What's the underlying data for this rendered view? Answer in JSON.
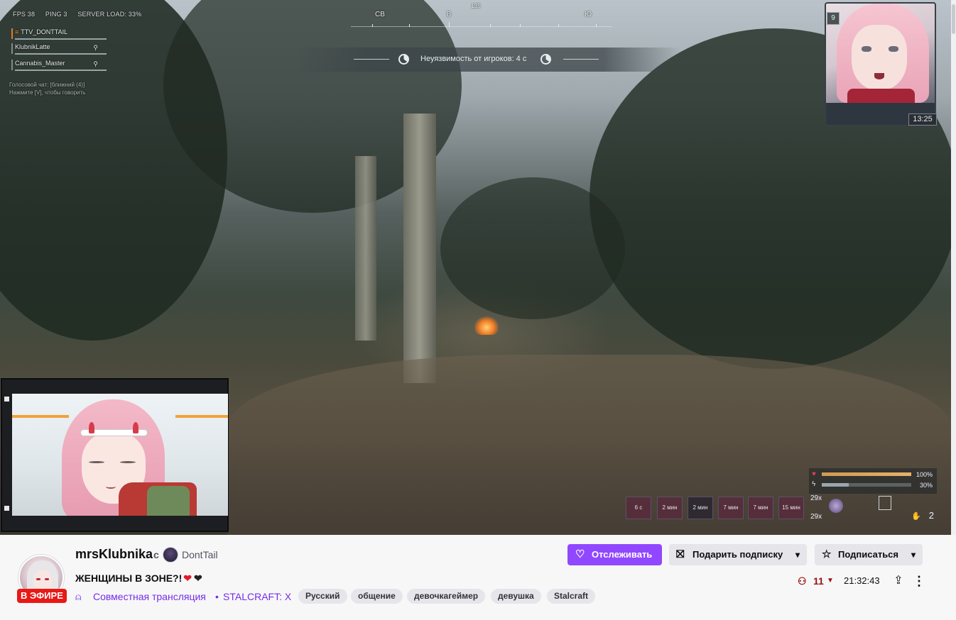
{
  "hud": {
    "fps": "FPS 38",
    "ping": "PING 3",
    "server_load": "SERVER LOAD: 33%",
    "party": [
      {
        "name": "TTV_DONTTAIL"
      },
      {
        "name": "KlubnikLatte"
      },
      {
        "name": "Cannabis_Master"
      }
    ],
    "voice_hint_1": "Голосовой чат: [ближний (4)]",
    "voice_hint_2": "Нажмите [V], чтобы говорить",
    "compass": {
      "nw": "СВ",
      "east": "В",
      "tick_135": "135",
      "south_e": "Ю"
    },
    "invulnerability": "Неуязвимость от игроков: 4 с",
    "cam_badge": "9",
    "cam_time": "13:25",
    "hp_pct": "100%",
    "stamina_pct": "30%",
    "hp_fill": 1.0,
    "stamina_fill": 0.3,
    "buffs": [
      "6 с",
      "2 мин",
      "2 мин",
      "7 мин",
      "7 мин",
      "15 мин"
    ],
    "item_count_top": "29x",
    "item_count_bottom": "29x",
    "ammo": "2"
  },
  "channel": {
    "name": "mrsKlubnika",
    "with": "с",
    "collab_name": "DontTail",
    "live_badge": "В ЭФИРЕ",
    "title": "ЖЕНЩИНЫ В ЗОНЕ?!",
    "collab_link": "Совместная трансляция",
    "separator": "•",
    "game": "STALCRAFT: X",
    "tags": [
      "Русский",
      "общение",
      "девочкагеймер",
      "девушка",
      "Stalcraft"
    ]
  },
  "actions": {
    "follow": "Отслеживать",
    "gift": "Подарить подписку",
    "subscribe": "Подписаться"
  },
  "stats": {
    "viewers": "11",
    "uptime": "21:32:43"
  },
  "colors": {
    "accent": "#9147ff",
    "live": "#e91916",
    "link": "#772ce8",
    "viewers": "#971311"
  }
}
